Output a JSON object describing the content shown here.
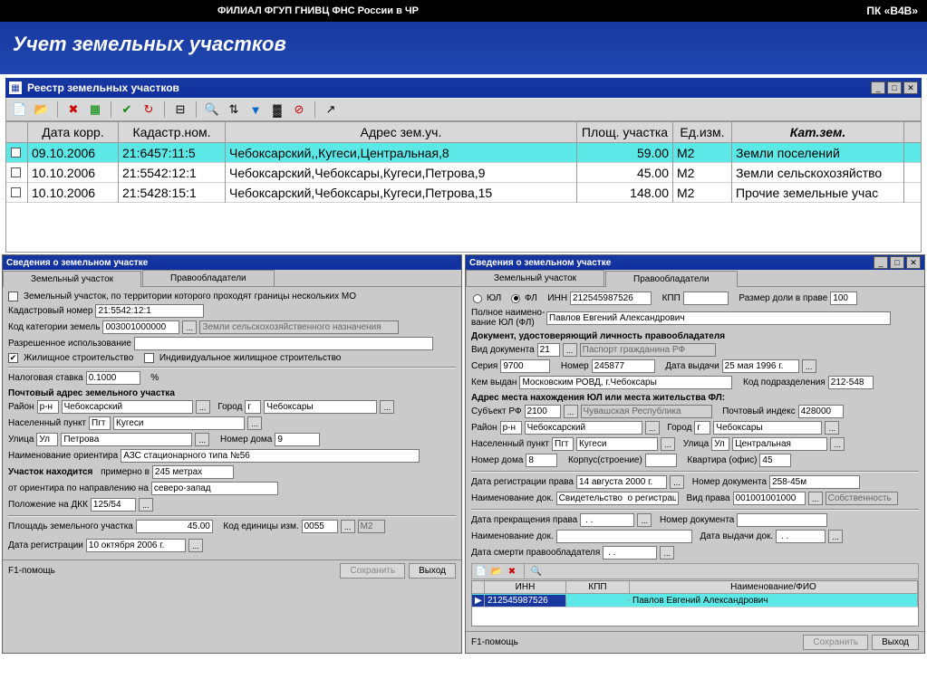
{
  "header": {
    "org": "ФИЛИАЛ ФГУП ГНИВЦ ФНС России в ЧР",
    "app": "ПК «В4В»",
    "title": "Учет земельных участков"
  },
  "registry": {
    "title": "Реестр земельных участков",
    "columns": [
      "",
      "Дата корр.",
      "Кадастр.ном.",
      "Адрес зем.уч.",
      "Площ. участка",
      "Ед.изм.",
      "Кат.зем."
    ],
    "rows": [
      {
        "sel": true,
        "date": "09.10.2006",
        "kad": "21:6457:11:5",
        "addr": "Чебоксарский,,Кугеси,Центральная,8",
        "area": "59.00",
        "unit": "М2",
        "cat": "Земли поселений"
      },
      {
        "sel": false,
        "date": "10.10.2006",
        "kad": "21:5542:12:1",
        "addr": "Чебоксарский,Чебоксары,Кугеси,Петрова,9",
        "area": "45.00",
        "unit": "М2",
        "cat": "Земли сельскохозяйство"
      },
      {
        "sel": false,
        "date": "10.10.2006",
        "kad": "21:5428:15:1",
        "addr": "Чебоксарский,Чебоксары,Кугеси,Петрова,15",
        "area": "148.00",
        "unit": "М2",
        "cat": "Прочие земельные учас"
      }
    ]
  },
  "left": {
    "title": "Сведения о земельном участке",
    "tabs": [
      "Земельный участок",
      "Правообладатели"
    ],
    "chk_multi": "Земельный участок, по территории которого проходят границы нескольких МО",
    "kadnum_lbl": "Кадастровый номер",
    "kadnum": "21:5542:12:1",
    "catcode_lbl": "Код категории земель",
    "catcode": "003001000000",
    "catname": "Земли сельскохозяйственного назначения",
    "usage_lbl": "Разрешенное использование",
    "usage": "",
    "chk_housing": "Жилищное строительство",
    "chk_indiv": "Индивидуальное жилищное строительство",
    "taxrate_lbl": "Налоговая ставка",
    "taxrate": "0.1000",
    "pct": "%",
    "post_sect": "Почтовый адрес земельного участка",
    "rayon_lbl": "Район",
    "rayon_pre": "р-н",
    "rayon": "Чебоксарский",
    "city_lbl": "Город",
    "city_pre": "г",
    "city": "Чебоксары",
    "np_lbl": "Населенный пункт",
    "np_pre": "Пгт",
    "np": "Кугеси",
    "street_lbl": "Улица",
    "street_pre": "Ул",
    "street": "Петрова",
    "house_lbl": "Номер дома",
    "house": "9",
    "orient_lbl": "Наименование ориентира",
    "orient": "АЗС стационарного типа №56",
    "loc_lbl": "Участок находится",
    "loc_mid": "примерно в",
    "dist": "245 метрах",
    "dir_lbl": "от ориентира по направлению на",
    "dir": "северо-запад",
    "dkk_lbl": "Положение на ДКК",
    "dkk": "125/54",
    "area_lbl": "Площадь земельного участка",
    "area": "45.00",
    "unitcode_lbl": "Код единицы изм.",
    "unitcode": "0055",
    "unitname": "М2",
    "regdate_lbl": "Дата регистрации",
    "regdate": "10 октября 2006 г."
  },
  "right": {
    "title": "Сведения о земельном участке",
    "tabs": [
      "Земельный участок",
      "Правообладатели"
    ],
    "ul": "ЮЛ",
    "fl": "ФЛ",
    "inn_lbl": "ИНН",
    "inn": "212545987526",
    "kpp_lbl": "КПП",
    "kpp": "",
    "share_lbl": "Размер доли в праве",
    "share": "100",
    "name_lbl1": "Полное наимено-",
    "name_lbl2": "вание ЮЛ (ФЛ)",
    "name": "Павлов Евгений Александрович",
    "doc_sect": "Документ, удостоверяющий личность правообладателя",
    "doctype_lbl": "Вид документа",
    "doctype": "21",
    "docname": "Паспорт гражданина РФ",
    "ser_lbl": "Серия",
    "ser": "9700",
    "num_lbl": "Номер",
    "num": "245877",
    "issued_lbl": "Дата выдачи",
    "issued": "25 мая 1996 г.",
    "by_lbl": "Кем выдан",
    "by": "Московским РОВД, г.Чебоксары",
    "subdiv_lbl": "Код подразделения",
    "subdiv": "212-548",
    "addr_sect": "Адрес места нахождения ЮЛ или места жительства ФЛ:",
    "subj_lbl": "Субъект РФ",
    "subj": "2100",
    "subjname": "Чувашская Республика",
    "zip_lbl": "Почтовый индекс",
    "zip": "428000",
    "rayon_lbl": "Район",
    "rayon_pre": "р-н",
    "rayon": "Чебоксарский",
    "city_lbl": "Город",
    "city_pre": "г",
    "city": "Чебоксары",
    "np_lbl": "Населенный пункт",
    "np_pre": "Пгт",
    "np": "Кугеси",
    "street_lbl": "Улица",
    "street_pre": "Ул",
    "street": "Центральная",
    "house_lbl": "Номер дома",
    "house": "8",
    "corp_lbl": "Корпус(строение)",
    "corp": "",
    "apt_lbl": "Квартира (офис)",
    "apt": "45",
    "regdate_lbl": "Дата регистрации права",
    "regdate": "14 августа 2000 г.",
    "docnum_lbl": "Номер документа",
    "docnum": "258-45м",
    "docname_lbl": "Наименование док.",
    "docname2": "Свидетельство  о регистраци",
    "rtype_lbl": "Вид права",
    "rtype": "001001001000",
    "rtypename": "Собственность",
    "end_lbl": "Дата прекращения права",
    "end": " . .",
    "enddocnum_lbl": "Номер документа",
    "enddocnum": "",
    "enddocname_lbl": "Наименование док.",
    "enddocname": "",
    "enddocdate_lbl": "Дата выдачи док.",
    "enddocdate": " . .",
    "death_lbl": "Дата смерти правообладателя",
    "death": " . .",
    "grid_cols": [
      "ИНН",
      "КПП",
      "Наименование/ФИО"
    ],
    "grid_row": {
      "inn": "212545987526",
      "kpp": "",
      "name": "Павлов Евгений Александрович"
    }
  },
  "footer": {
    "help": "F1-помощь",
    "save": "Сохранить",
    "exit": "Выход"
  }
}
